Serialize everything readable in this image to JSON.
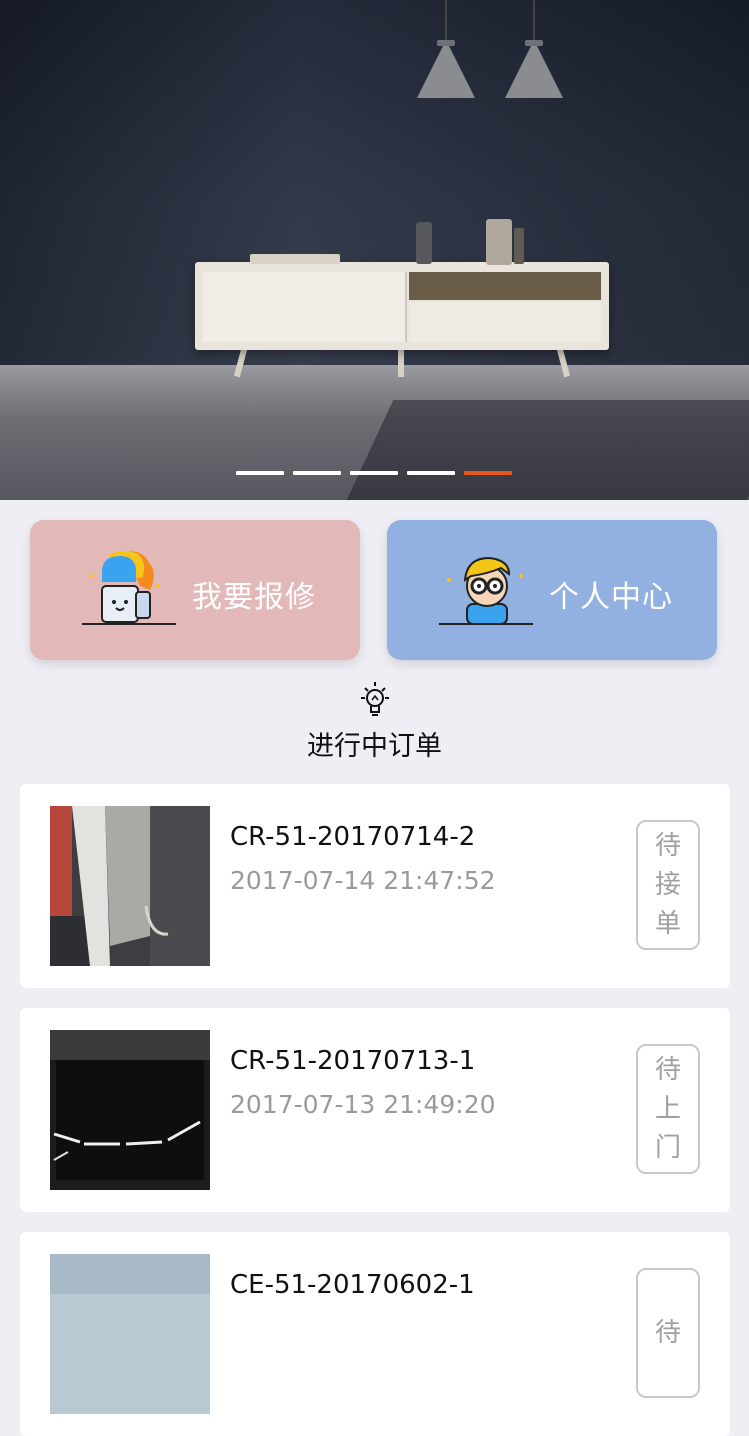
{
  "banner": {
    "slide_count": 5,
    "active_index": 4,
    "accent_color": "#e8561c"
  },
  "actions": [
    {
      "label": "我要报修",
      "color": "#e3b8b9",
      "icon": "repair-character-icon"
    },
    {
      "label": "个人中心",
      "color": "#93b1e0",
      "icon": "user-character-icon"
    }
  ],
  "section": {
    "icon": "lightbulb-icon",
    "title": "进行中订单"
  },
  "orders": [
    {
      "code": "CR-51-20170714-2",
      "time": "2017-07-14 21:47:52",
      "status": [
        "待",
        "接",
        "单"
      ]
    },
    {
      "code": "CR-51-20170713-1",
      "time": "2017-07-13 21:49:20",
      "status": [
        "待",
        "上",
        "门"
      ]
    },
    {
      "code": "CE-51-20170602-1",
      "time": "",
      "status": [
        "待"
      ]
    }
  ]
}
